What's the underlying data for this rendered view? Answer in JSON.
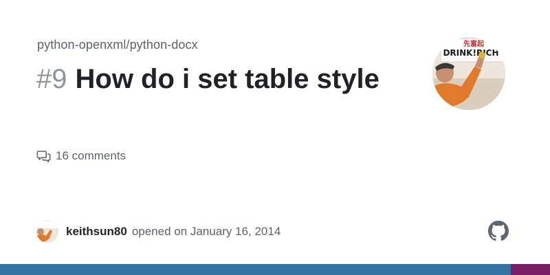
{
  "repo": "python-openxml/python-docx",
  "issue": {
    "number": "#9",
    "title": "How do i set table style",
    "comments": "16 comments"
  },
  "avatar": {
    "sign_top": "先富起",
    "sign_bottom": "DRINK!RICH"
  },
  "author": {
    "username": "keithsun80",
    "opened_text": "opened on January 16, 2014"
  },
  "icons": {
    "comments": "comment-discussion-icon",
    "brand": "github-mark-icon"
  },
  "colors": {
    "bar_primary": "#3572a5",
    "bar_secondary": "#7b1f69",
    "title": "#1f2328",
    "muted": "#59636e",
    "number": "#8c959f"
  }
}
